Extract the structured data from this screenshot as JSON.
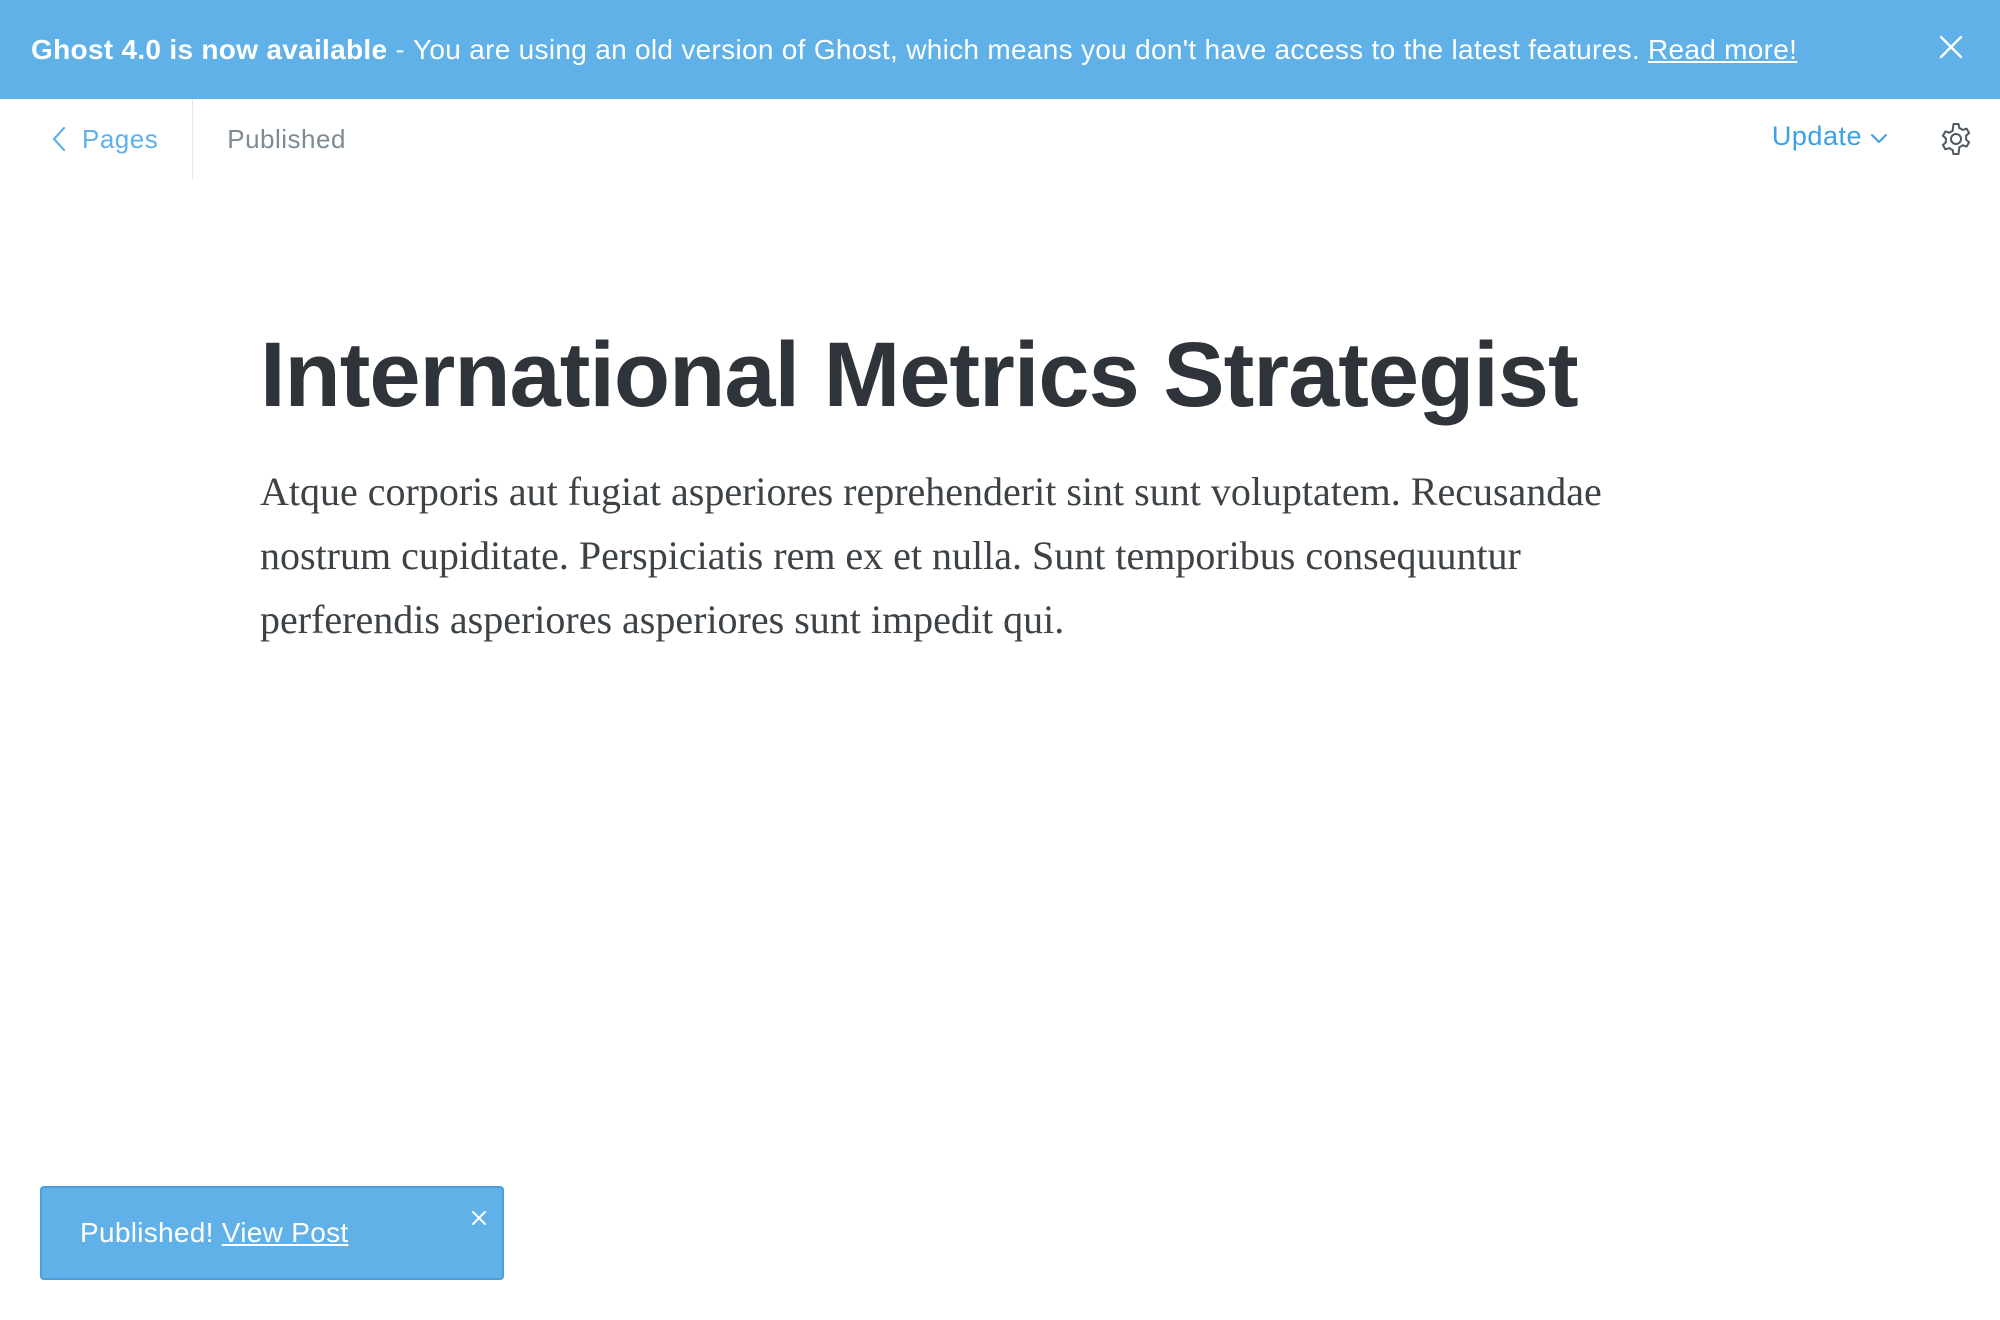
{
  "banner": {
    "headline": "Ghost 4.0 is now available",
    "separator": "-",
    "message": "You are using an old version of Ghost, which means you don't have access to the latest features.",
    "link_label": "Read more!",
    "close_icon": "close-icon",
    "background_color": "#5fb1e8"
  },
  "toolbar": {
    "back_label": "Pages",
    "back_icon": "chevron-left-icon",
    "status": "Published",
    "update_label": "Update",
    "update_icon": "chevron-down-icon",
    "settings_icon": "gear-icon",
    "accent_color": "#3ba0e4"
  },
  "editor": {
    "title": "International Metrics Strategist",
    "body": "Atque corporis aut fugiat asperiores reprehenderit sint sunt voluptatem. Recusandae nostrum cupiditate. Perspiciatis rem ex et nulla. Sunt temporibus consequuntur perferendis asperiores asperiores sunt impedit qui."
  },
  "toast": {
    "message": "Published!",
    "link_label": "View Post",
    "close_icon": "close-icon"
  }
}
